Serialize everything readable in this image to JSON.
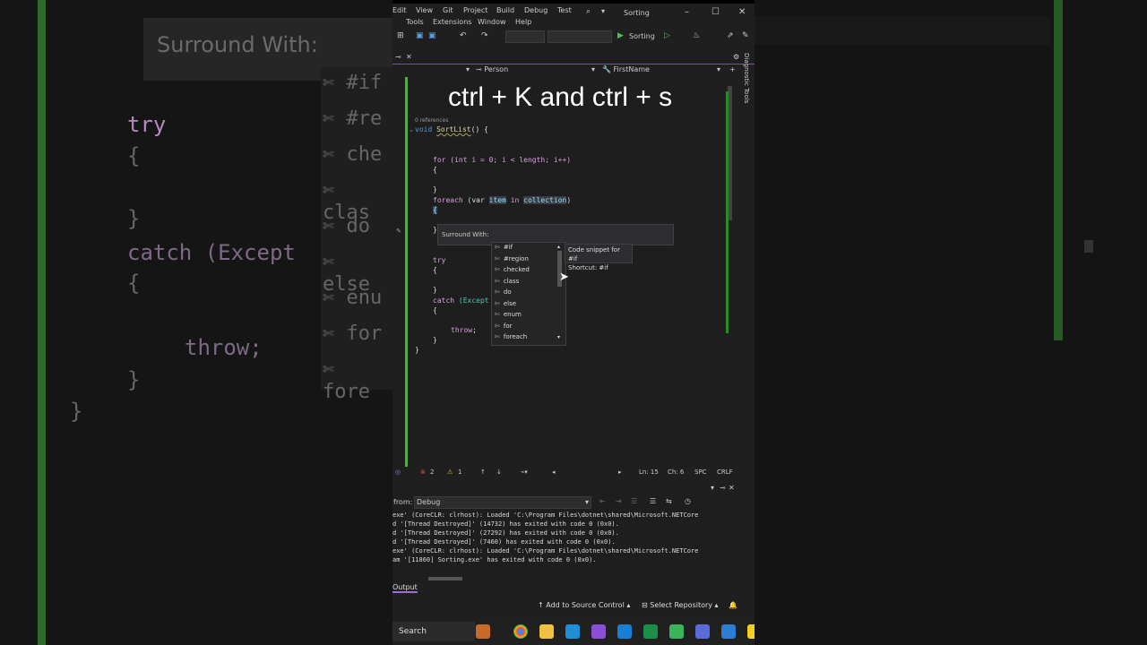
{
  "caption": "ctrl + K and ctrl + s",
  "background": {
    "surround_label": "Surround With:",
    "items": [
      "#if",
      "#re",
      "che",
      "clas",
      "do",
      "else",
      "enu",
      "for",
      "fore"
    ],
    "code": {
      "try": "try",
      "catch": "catch (Except",
      "throw": "throw;"
    }
  },
  "menu": {
    "row1": [
      "Edit",
      "View",
      "Git",
      "Project",
      "Build",
      "Debug",
      "Test"
    ],
    "row2": [
      "Tools",
      "Extensions",
      "Window",
      "Help"
    ],
    "title": "Sorting"
  },
  "toolbar": {
    "run_label": "Sorting"
  },
  "nav": {
    "class": "Person",
    "member": "FirstName"
  },
  "editor": {
    "references": "0 references",
    "line_signature": {
      "kw": "void",
      "name": "SortList",
      "rest": "() {"
    },
    "line_for": "for (int i = 0; i < length; i++)",
    "line_foreach_kw": "foreach",
    "line_foreach_mid": " (var ",
    "line_foreach_item": "item",
    "line_foreach_in": " in ",
    "line_foreach_coll": "collection",
    "line_foreach_end": ")",
    "open_brace": "{",
    "close_brace": "}",
    "line_try": "try",
    "line_catch_kw": "catch",
    "line_catch_rest": " (Except",
    "line_throw_kw": "throw",
    "line_throw_end": ";"
  },
  "surround": {
    "label": "Surround With:",
    "snippets": [
      "#if",
      "#region",
      "checked",
      "class",
      "do",
      "else",
      "enum",
      "for",
      "foreach"
    ],
    "tooltip_line1": "Code snippet for #if",
    "tooltip_line2": "Shortcut: #if"
  },
  "status": {
    "errors": "2",
    "warnings": "1",
    "line": "Ln: 15",
    "col": "Ch: 6",
    "spc": "SPC",
    "eol": "CRLF"
  },
  "output": {
    "from_label": "from:",
    "source": "Debug",
    "lines": [
      "exe' (CoreCLR: clrhost): Loaded 'C:\\Program Files\\dotnet\\shared\\Microsoft.NETCore",
      "d '[Thread Destroyed]' (14732) has exited with code 0 (0x0).",
      "d '[Thread Destroyed]' (27292) has exited with code 0 (0x0).",
      "d '[Thread Destroyed]' (7460) has exited with code 0 (0x0).",
      "exe' (CoreCLR: clrhost): Loaded 'C:\\Program Files\\dotnet\\shared\\Microsoft.NETCore",
      "am '[11860] Sorting.exe' has exited with code 0 (0x0)."
    ],
    "tab": "Output"
  },
  "source_control": {
    "add": "Add to Source Control",
    "repo": "Select Repository"
  },
  "taskbar": {
    "search": "Search"
  },
  "side": {
    "diag": "Diagnostic Tools"
  }
}
